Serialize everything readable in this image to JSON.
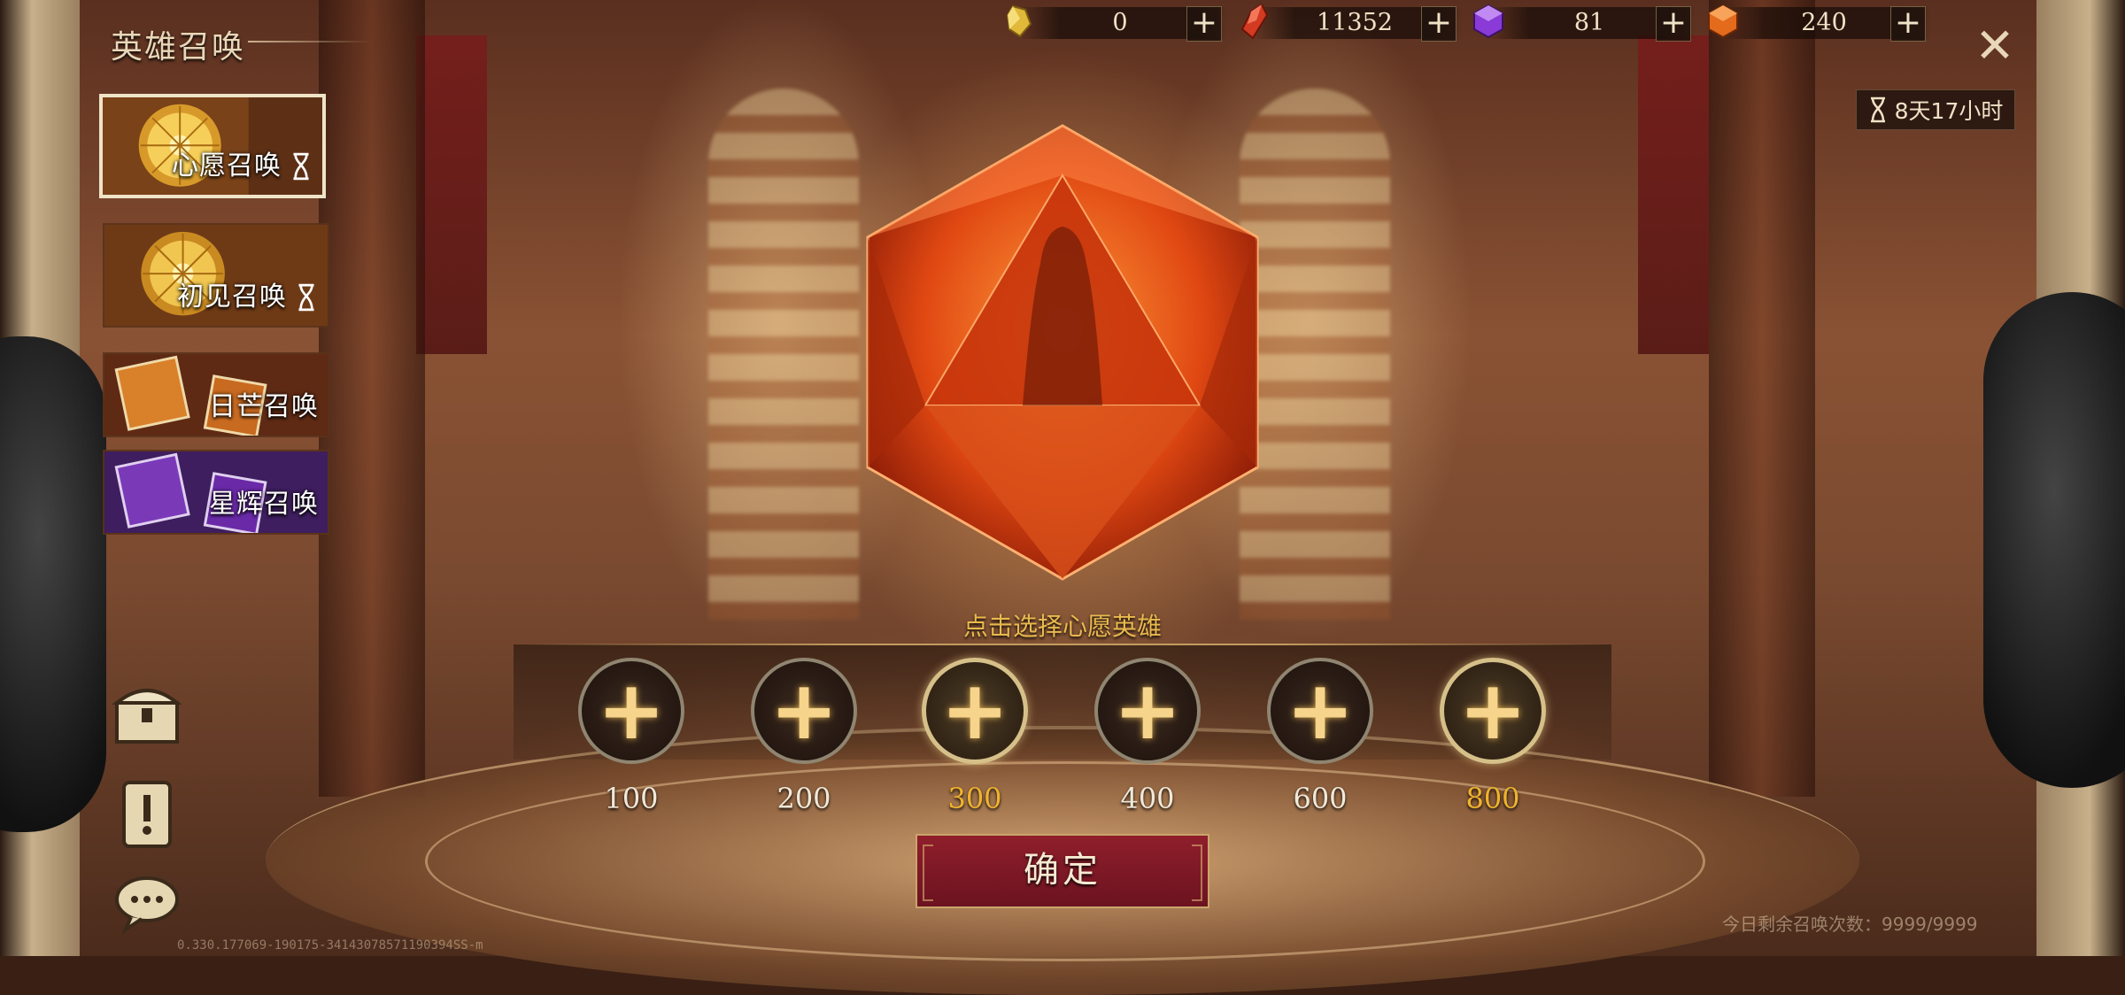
{
  "header": {
    "title": "英雄召唤"
  },
  "resources": [
    {
      "icon": "yellow-crystal-icon",
      "value": "0",
      "color": "#e0b83a"
    },
    {
      "icon": "red-crystal-icon",
      "value": "11352",
      "color": "#d23a22"
    },
    {
      "icon": "purple-gem-icon",
      "value": "81",
      "color": "#8a3ad6"
    },
    {
      "icon": "orange-gem-icon",
      "value": "240",
      "color": "#e46a1c"
    }
  ],
  "plus_symbol": "+",
  "close_symbol": "✕",
  "timer": {
    "text": "8天17小时"
  },
  "tabs": [
    {
      "label": "心愿召唤",
      "active": true,
      "has_timer": true
    },
    {
      "label": "初见召唤",
      "active": false,
      "has_timer": true
    },
    {
      "label": "日芒召唤",
      "active": false,
      "has_timer": false
    },
    {
      "label": "星辉召唤",
      "active": false,
      "has_timer": false
    }
  ],
  "side_icons": [
    "treasure-chest-icon",
    "notice-scroll-icon",
    "chat-bubble-icon"
  ],
  "prompt": "点击选择心愿英雄",
  "slots": [
    {
      "label": "100",
      "highlight": false
    },
    {
      "label": "200",
      "highlight": false
    },
    {
      "label": "300",
      "highlight": true
    },
    {
      "label": "400",
      "highlight": false
    },
    {
      "label": "600",
      "highlight": false
    },
    {
      "label": "800",
      "highlight": true
    }
  ],
  "confirm_label": "确定",
  "remaining_text": "今日剩余召唤次数：9999/9999",
  "build_text": "0.330.177069-190175-34143078571190394SS-m",
  "colors": {
    "gold": "#f0b42c",
    "confirm": "#8f1e2b",
    "prompt": "#e9b94d"
  }
}
